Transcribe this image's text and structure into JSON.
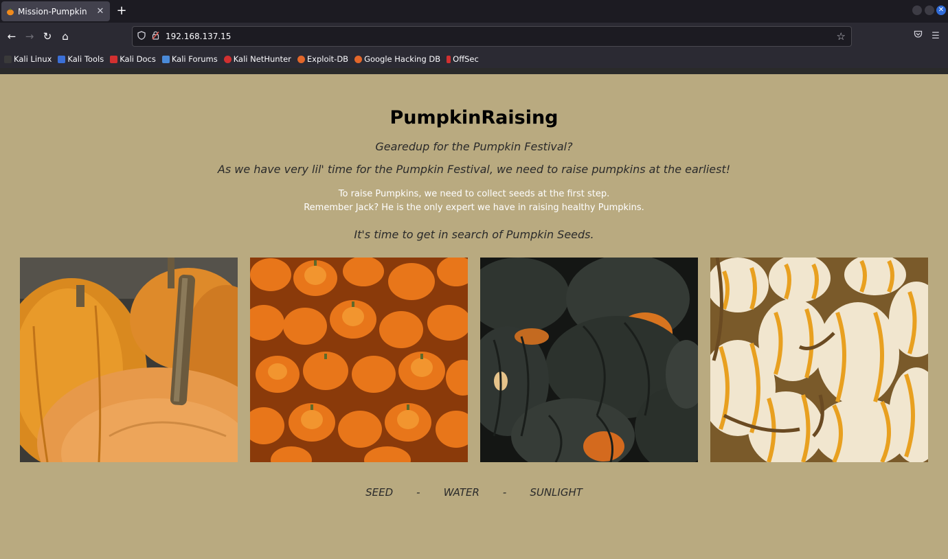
{
  "browser": {
    "tab_title": "Mission-Pumpkin",
    "url": "192.168.137.15",
    "bookmarks": [
      {
        "label": "Kali Linux",
        "icon": "kali-dragon-icon",
        "color": "#3a3a3a"
      },
      {
        "label": "Kali Tools",
        "icon": "kali-tools-icon",
        "color": "#3b6fd6"
      },
      {
        "label": "Kali Docs",
        "icon": "kali-docs-icon",
        "color": "#d23030"
      },
      {
        "label": "Kali Forums",
        "icon": "kali-forums-icon",
        "color": "#4a8ad8"
      },
      {
        "label": "Kali NetHunter",
        "icon": "kali-nethunter-icon",
        "color": "#d23030"
      },
      {
        "label": "Exploit-DB",
        "icon": "exploit-db-icon",
        "color": "#e3672a"
      },
      {
        "label": "Google Hacking DB",
        "icon": "ghdb-icon",
        "color": "#e3672a"
      },
      {
        "label": "OffSec",
        "icon": "offsec-icon",
        "color": "#d23030"
      }
    ],
    "accent": "#2f6bd8"
  },
  "page": {
    "background": "#b9aa80",
    "heading": "PumpkinRaising",
    "tagline": "Gearedup for the Pumpkin Festival?",
    "subtitle": "As we have very lil' time for the Pumpkin Festival, we need to raise pumpkins at the earliest!",
    "info_line1": "To raise Pumpkins, we need to collect seeds at the first step.",
    "info_line2": "Remember Jack? He is the only expert we have in raising healthy Pumpkins.",
    "call_to_action": "It's time to get in search of Pumpkin Seeds.",
    "images": [
      {
        "name": "large-orange-pumpkins-photo"
      },
      {
        "name": "small-orange-pumpkins-photo"
      },
      {
        "name": "dark-green-acorn-squash-photo"
      },
      {
        "name": "white-striped-pumpkins-photo"
      }
    ],
    "footer": {
      "word1": "SEED",
      "sep1": "-",
      "word2": "WATER",
      "sep2": "-",
      "word3": "SUNLIGHT"
    }
  }
}
